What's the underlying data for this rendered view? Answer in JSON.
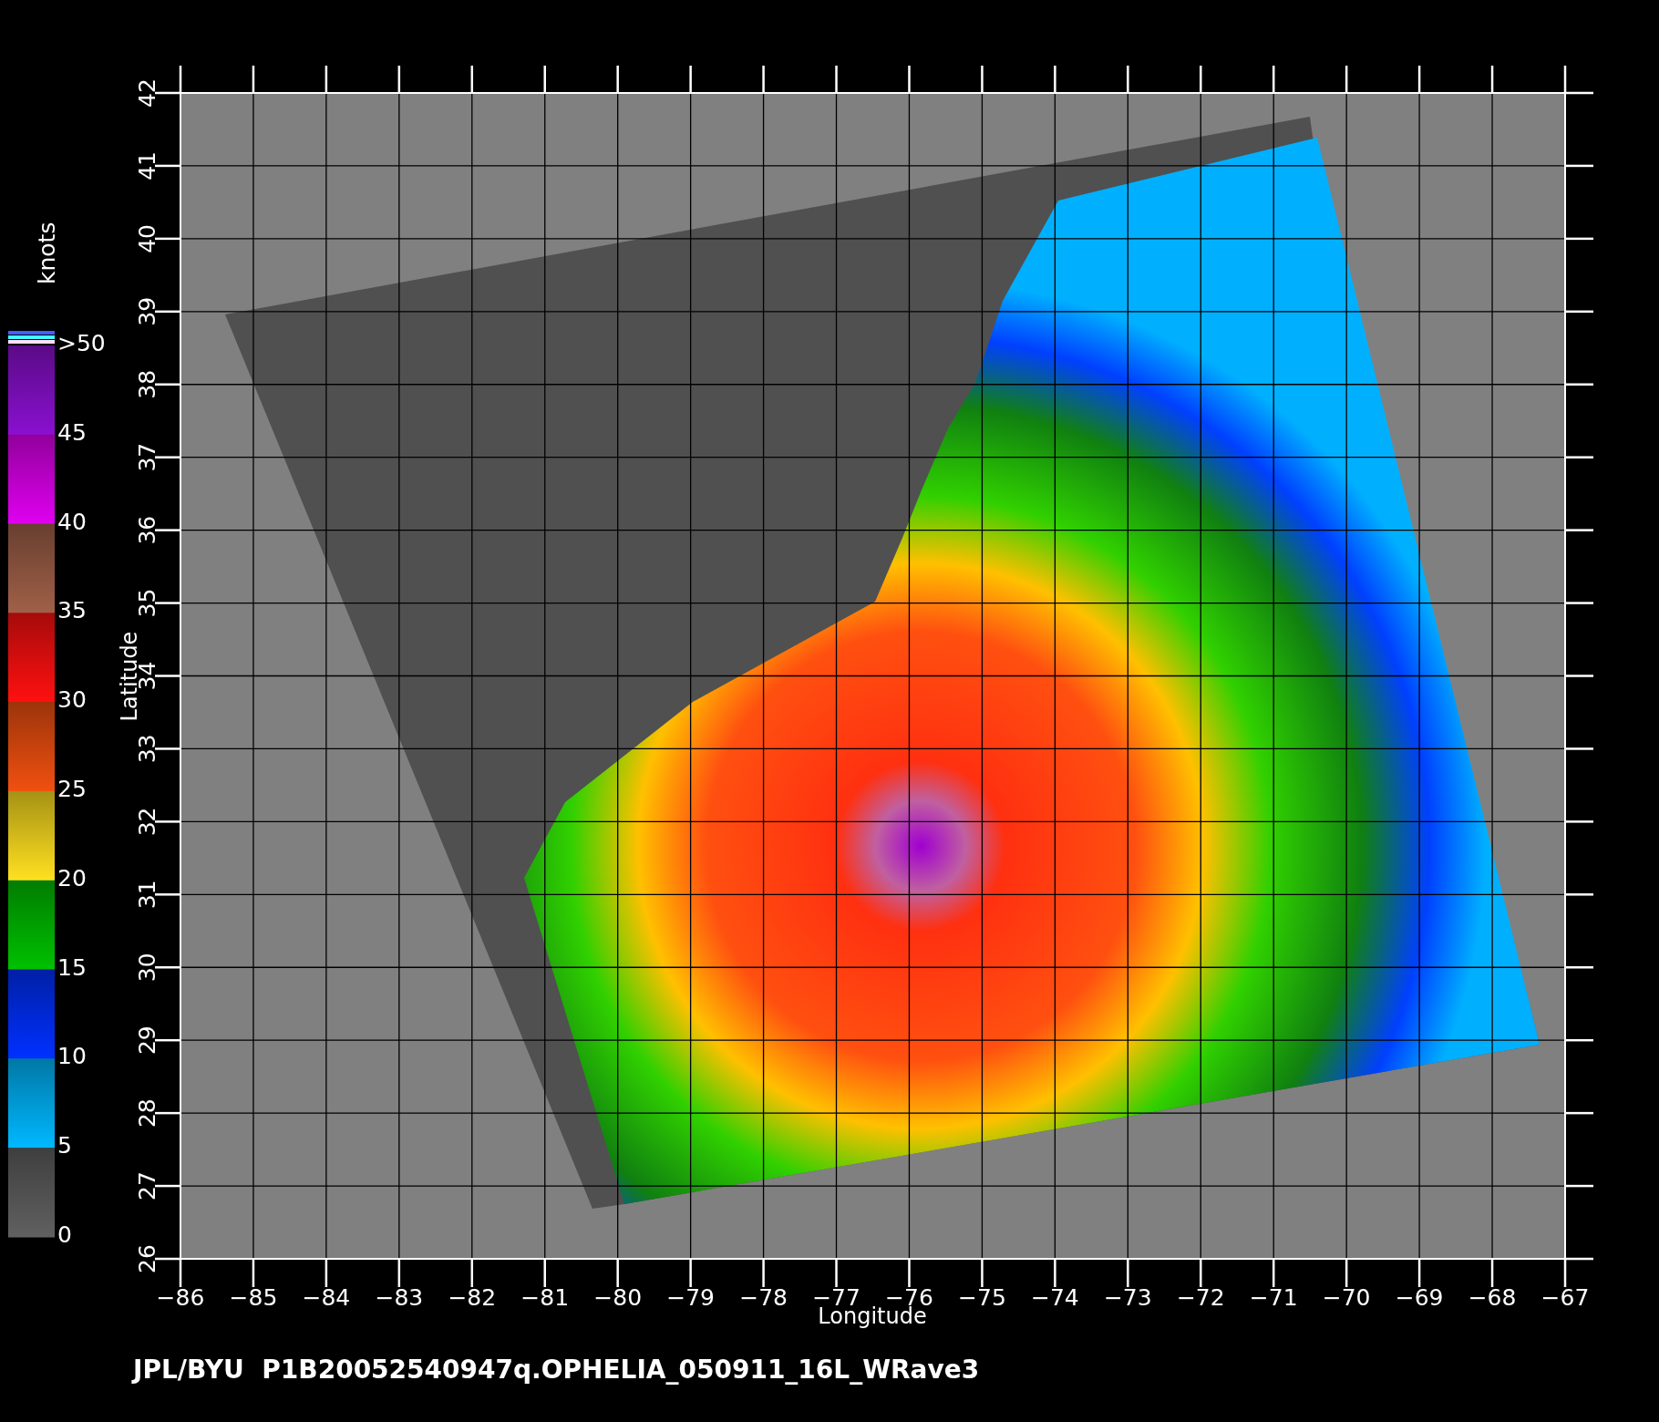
{
  "colorbar": {
    "unit": "knots",
    "labels": [
      ">50",
      "45",
      "40",
      "35",
      "30",
      "25",
      "20",
      "15",
      "10",
      "5",
      "0"
    ],
    "bands": [
      {
        "color": "#8a10d0"
      },
      {
        "color": "#e000f0"
      },
      {
        "color": "#a06048"
      },
      {
        "color": "#ff1010"
      },
      {
        "color": "#f05010"
      },
      {
        "color": "#ffe020"
      },
      {
        "color": "#00c000"
      },
      {
        "color": "#0030ff"
      },
      {
        "color": "#00b8ff"
      },
      {
        "color": "#606060"
      }
    ]
  },
  "plot": {
    "ylabel": "Latitude",
    "xlabel": "Longitude",
    "yticks": [
      "42",
      "41",
      "40",
      "39",
      "38",
      "37",
      "36",
      "35",
      "34",
      "33",
      "32",
      "31",
      "30",
      "29",
      "28",
      "27",
      "26"
    ],
    "xticks": [
      "−86",
      "−85",
      "−84",
      "−83",
      "−82",
      "−81",
      "−80",
      "−79",
      "−78",
      "−77",
      "−76",
      "−75",
      "−74",
      "−73",
      "−72",
      "−71",
      "−70",
      "−69",
      "−68",
      "−67"
    ]
  },
  "caption": "JPL/BYU  P1B20052540947q.OPHELIA_050911_16L_WRave3"
}
